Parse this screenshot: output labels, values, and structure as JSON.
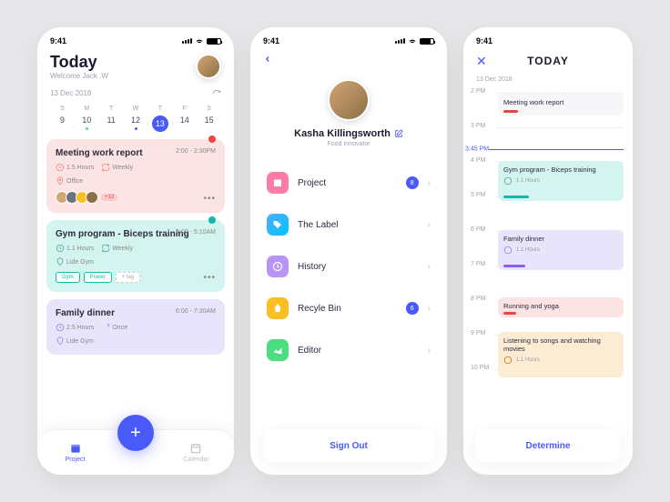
{
  "status": {
    "time": "9:41"
  },
  "screen1": {
    "title": "Today",
    "welcome": "Welcome Jack .W",
    "date": "13 Dec 2018",
    "days": [
      "S",
      "M",
      "T",
      "W",
      "T",
      "F",
      "S"
    ],
    "nums": [
      "9",
      "10",
      "11",
      "12",
      "13",
      "14",
      "15"
    ],
    "activeIdx": 4,
    "cards": [
      {
        "title": "Meeting work report",
        "time": "2:00 - 2:30PM",
        "duration": "1.5 Hours",
        "repeat": "Weekly",
        "location": "Office",
        "more": "+12"
      },
      {
        "title": "Gym program - Biceps training",
        "time": "4:00 - 5:10AM",
        "duration": "1.1 Hours",
        "repeat": "Weekly",
        "location": "Lide Gym",
        "tags": [
          "Gym",
          "Power"
        ],
        "addTag": "+ tag"
      },
      {
        "title": "Family dinner",
        "time": "6:00 - 7:30AM",
        "duration": "2.5 Hours",
        "repeat": "Once",
        "location": "Lide Gym"
      }
    ],
    "tabs": {
      "project": "Project",
      "calendar": "Calendar"
    }
  },
  "screen2": {
    "name": "Kasha Killingsworth",
    "role": "Food Innovator",
    "menu": [
      {
        "label": "Project",
        "badge": "8"
      },
      {
        "label": "The Label"
      },
      {
        "label": "History"
      },
      {
        "label": "Recyle Bin",
        "badge": "6"
      },
      {
        "label": "Editor"
      }
    ],
    "signout": "Sign Out"
  },
  "screen3": {
    "title": "TODAY",
    "date": "13 Dec 2018",
    "hours": [
      "2 PM",
      "3 PM",
      "4 PM",
      "5 PM",
      "6 PM",
      "7 PM",
      "8 PM",
      "9 PM",
      "10 PM"
    ],
    "now": "3:45 PM",
    "events": [
      {
        "title": "Meeting work report"
      },
      {
        "title": "Gym program - Biceps training",
        "dur": "1.1 Hours"
      },
      {
        "title": "Family dinner",
        "dur": "1.1 Hours"
      },
      {
        "title": "Running and yoga"
      },
      {
        "title": "Listening to songs and watching movies",
        "dur": "1.1 Hours"
      }
    ],
    "button": "Determine"
  }
}
